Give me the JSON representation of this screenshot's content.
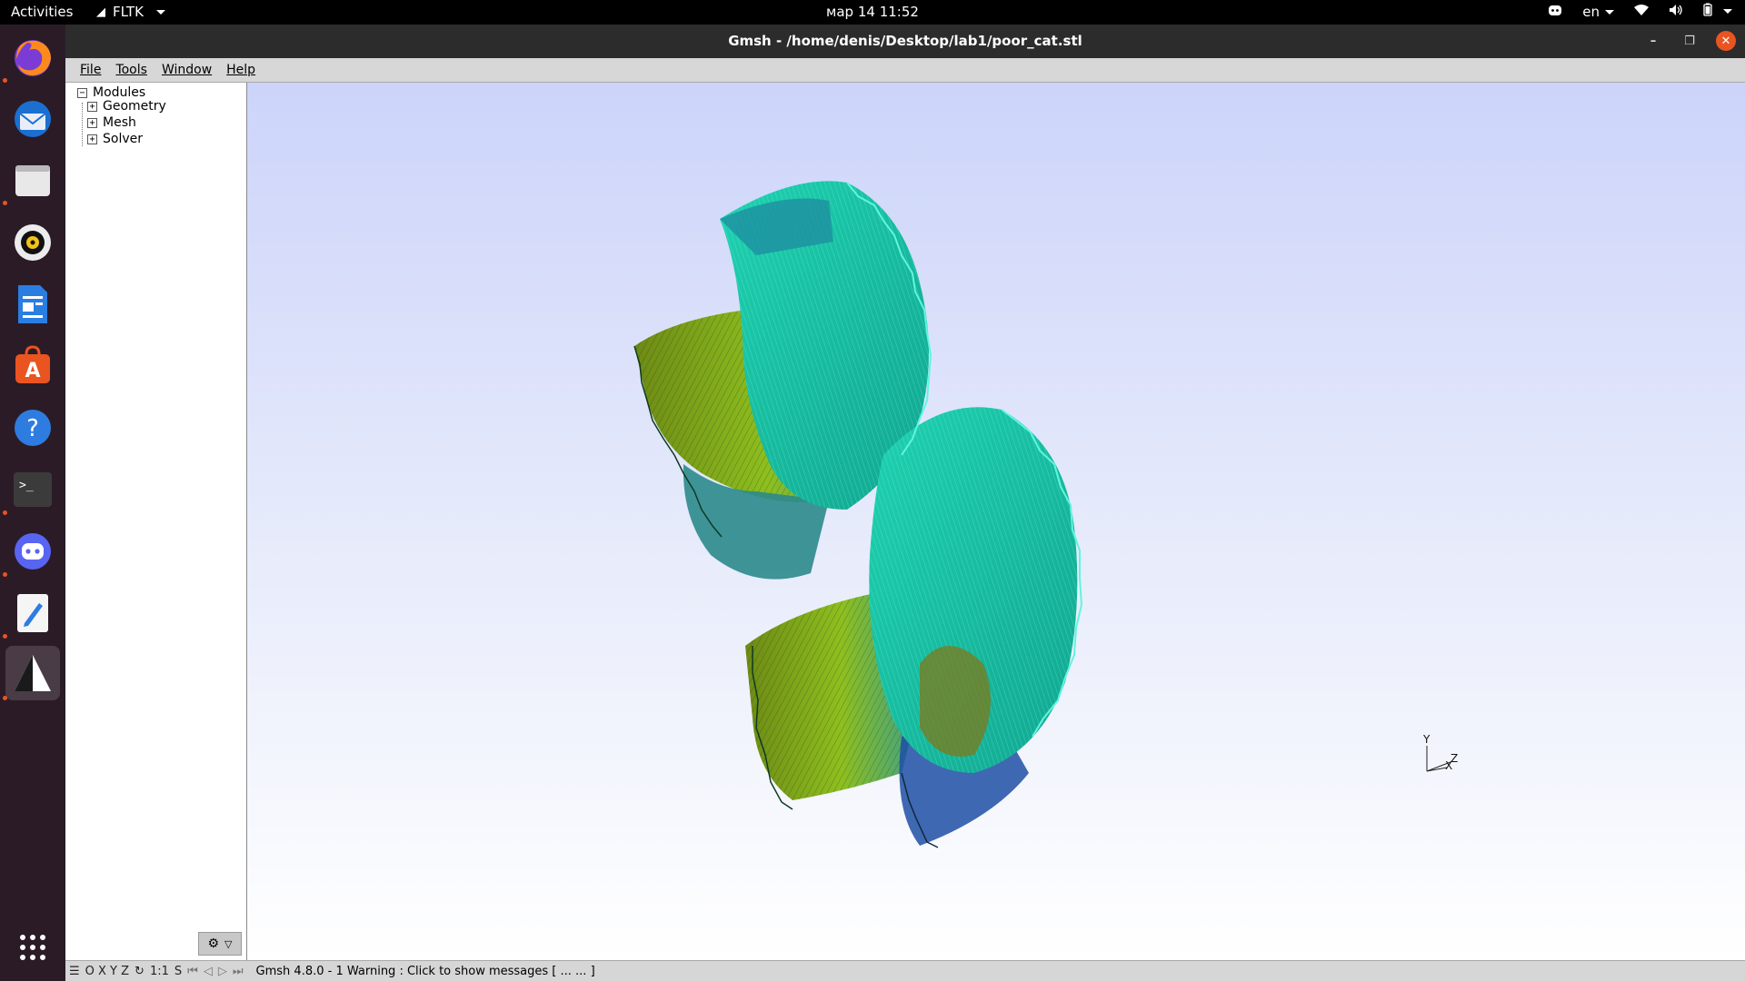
{
  "topbar": {
    "activities": "Activities",
    "app_name": "FLTK",
    "clock": "мар 14  11:52",
    "language": "en"
  },
  "dock": {
    "items": [
      "firefox-icon",
      "thunderbird-icon",
      "files-icon",
      "rhythmbox-icon",
      "writer-icon",
      "software-icon",
      "help-icon",
      "terminal-icon",
      "discord-icon",
      "text-editor-icon",
      "gmsh-icon"
    ]
  },
  "window": {
    "title": "Gmsh - /home/denis/Desktop/lab1/poor_cat.stl"
  },
  "menu": {
    "file": "File",
    "tools": "Tools",
    "window": "Window",
    "help": "Help"
  },
  "tree": {
    "root": "Modules",
    "children": [
      "Geometry",
      "Mesh",
      "Solver"
    ]
  },
  "axes": {
    "y": "Y",
    "z": "Z",
    "x": "X"
  },
  "statusbar": {
    "view_buttons": "O X Y Z",
    "scale": "1:1",
    "s": "S",
    "message": "Gmsh 4.8.0  -  1 Warning : Click to show messages [ ...  ... ]"
  },
  "colors": {
    "mesh_cyan": "#2ee6c4",
    "mesh_green": "#8fbf1e",
    "mesh_blue": "#1f4fa6",
    "accent": "#e95420"
  }
}
